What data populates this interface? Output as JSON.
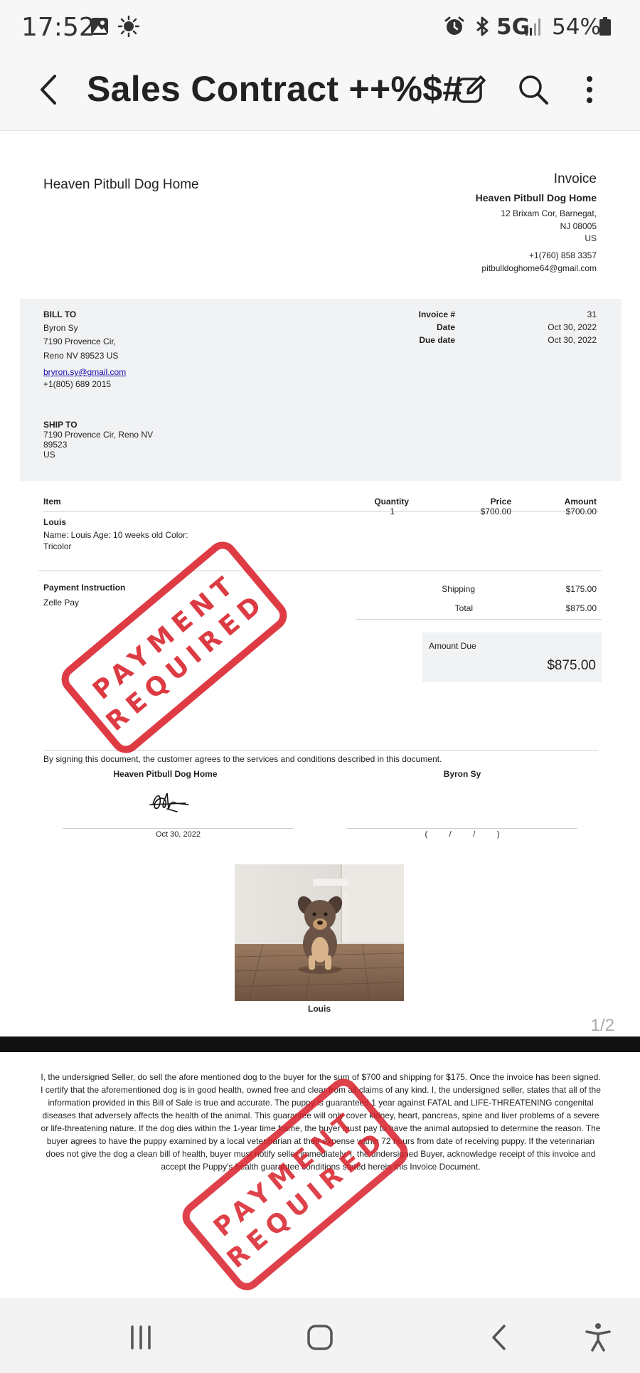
{
  "status_bar": {
    "time": "17:52",
    "network": "5G",
    "battery": "54%",
    "icons": [
      "gallery-icon",
      "brightness-icon",
      "alarm-icon",
      "bluetooth-icon",
      "signal-icon",
      "battery-icon"
    ]
  },
  "app_bar": {
    "title": "Sales Contract ++%$#",
    "icons": [
      "back-icon",
      "edit-icon",
      "search-icon",
      "more-icon"
    ]
  },
  "invoice": {
    "company_left": "Heaven Pitbull Dog Home",
    "heading": "Invoice",
    "company_name": "Heaven Pitbull Dog Home",
    "address1": "12 Brixam Cor, Barnegat,",
    "address2": "NJ 08005",
    "country": "US",
    "phone": "+1(760) 858 3357",
    "email": "pitbulldoghome64@gmail.com"
  },
  "bill_to": {
    "label": "BILL TO",
    "name": "Byron Sy",
    "address1": "7190 Provence Cir,",
    "address2": "Reno NV 89523 US",
    "email": "bryron.sy@gmail.com",
    "phone": "+1(805) 689 2015"
  },
  "meta": {
    "invoice_label": "Invoice #",
    "invoice_value": "31",
    "date_label": "Date",
    "date_value": "Oct 30, 2022",
    "due_label": "Due date",
    "due_value": "Oct 30, 2022"
  },
  "ship_to": {
    "label": "SHIP TO",
    "line1": "7190 Provence Cir, Reno NV",
    "line2": "89523",
    "line3": "US"
  },
  "items_table": {
    "headers": {
      "item": "Item",
      "quantity": "Quantity",
      "price": "Price",
      "amount": "Amount"
    },
    "rows": [
      {
        "name": "Louis",
        "desc1": "Name: Louis Age: 10 weeks old Color:",
        "desc2": "Tricolor",
        "quantity": "1",
        "price": "$700.00",
        "amount": "$700.00"
      }
    ]
  },
  "payment": {
    "label": "Payment Instruction",
    "method": "Zelle Pay"
  },
  "totals": {
    "shipping_label": "Shipping",
    "shipping_value": "$175.00",
    "total_label": "Total",
    "total_value": "$875.00",
    "amount_due_label": "Amount Due",
    "amount_due_value": "$875.00"
  },
  "signature": {
    "agreement": "By signing this document, the customer agrees to the services and conditions described in this document.",
    "seller": "Heaven Pitbull Dog Home",
    "buyer": "Byron Sy",
    "seller_date": "Oct 30, 2022",
    "buyer_date": "(          /          /          )"
  },
  "photo_caption": "Louis",
  "page_indicator": "1/2",
  "stamp": {
    "line1": "PAYMENT",
    "line2": "REQUIRED",
    "color": "#d9202a"
  },
  "terms": "I, the undersigned Seller, do sell the afore mentioned dog to the buyer for the sum of $700 and shipping for $175. Once the invoice has been signed. I certify that the aforementioned dog is in good health, owned free and clear from all claims of any kind. I, the undersigned seller, states that all of the information provided in this Bill of Sale is true and accurate. The puppy is guaranteed 1 year against FATAL and LIFE-THREATENING congenital diseases that adversely affects the health of the animal. This guarantee will only cover kidney,  heart, pancreas, spine and liver problems of a severe or life-threatening nature. If the dog dies within the 1-year time frame, the buyer must pay to have the animal autopsied to determine the reason. The buyer agrees to have the puppy examined by a local veterinarian at their expense within 72 hours from date of receiving puppy. If the veterinarian does not give the dog a clean bill of health, buyer must notify seller    immediately. I, the undersigned Buyer, acknowledge receipt of this invoice and accept the Puppy's health guarantee conditions stated herein   this Invoice Document.",
  "nav_bar": {
    "icons": [
      "recents-icon",
      "home-icon",
      "back-nav-icon",
      "accessibility-icon"
    ]
  }
}
